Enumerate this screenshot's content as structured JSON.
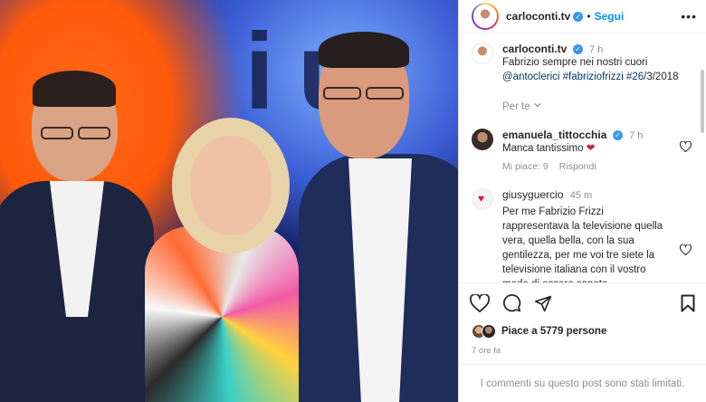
{
  "post": {
    "author": "carloconti.tv",
    "follow_label": "Segui",
    "separator": "•",
    "more_label": "•••"
  },
  "caption": {
    "author": "carloconti.tv",
    "time": "7 h",
    "line1": "Fabrizio sempre nei nostri cuori",
    "mention": "@antoclerici",
    "hashtags": "#fabriziofrizzi #26",
    "date_suffix": "/3/2018",
    "per_te_label": "Per te"
  },
  "comments": [
    {
      "author": "emanuela_tittocchia",
      "time": "7 h",
      "text": "Manca tantissimo",
      "likes_label": "Mi piace: 9",
      "reply_label": "Rispondi"
    },
    {
      "author": "giusyguercio",
      "time": "45 m",
      "text": "Per me Fabrizio Frizzi rappresentava la televisione quella vera, quella bella, con la sua gentilezza, per me voi tre siete la televisione italiana con il vostro modo di essere sapete"
    }
  ],
  "likes": {
    "label": "Piace a 5779 persone"
  },
  "timestamp": "7 ore fa",
  "footer_notice": "I commenti su questo post sono stati limitati.",
  "colors": {
    "accent": "#0095f6",
    "verified": "#3897f0",
    "muted": "#8e8e8e",
    "heart_red": "#d21f3c"
  }
}
